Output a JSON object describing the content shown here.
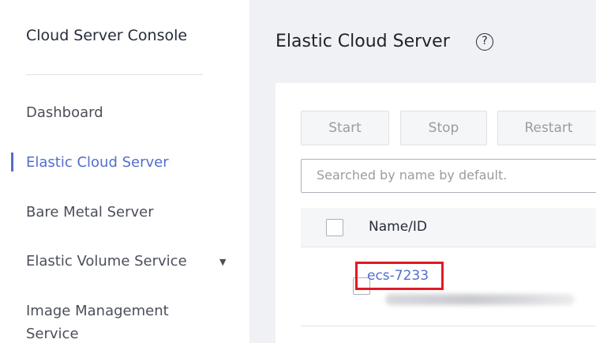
{
  "sidebar": {
    "title": "Cloud Server Console",
    "items": [
      {
        "label": "Dashboard"
      },
      {
        "label": "Elastic Cloud Server"
      },
      {
        "label": "Bare Metal Server"
      },
      {
        "label": "Elastic Volume Service"
      },
      {
        "label": "Image Management Service"
      }
    ],
    "active_item": "Elastic Cloud Server",
    "expand_icon": "caret-down-icon"
  },
  "main": {
    "title": "Elastic Cloud Server",
    "help_glyph": "?",
    "toolbar": {
      "start_label": "Start",
      "stop_label": "Stop",
      "restart_label": "Restart"
    },
    "search": {
      "placeholder": "Searched by name by default."
    },
    "table": {
      "columns": [
        "Name/ID"
      ],
      "rows": [
        {
          "name": "ecs-7233"
        }
      ]
    }
  },
  "colors": {
    "accent": "#526ecc",
    "highlight_box": "#e01b24",
    "panel_bg": "#eff1f5"
  }
}
